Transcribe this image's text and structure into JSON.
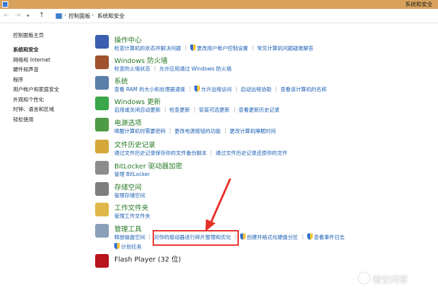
{
  "window": {
    "title": "系统和安全"
  },
  "navbar": {
    "back_icon": "back-arrow-icon",
    "forward_icon": "forward-arrow-icon",
    "recent_icon": "chevron-down-icon",
    "up_icon": "up-arrow-icon",
    "breadcrumbs": [
      "控制面板",
      "系统和安全"
    ]
  },
  "sidebar": {
    "home": "控制面板主页",
    "items": [
      {
        "label": "系统和安全",
        "active": true
      },
      {
        "label": "网络和 Internet"
      },
      {
        "label": "硬件和声音"
      },
      {
        "label": "程序"
      },
      {
        "label": "用户帐户和家庭安全"
      },
      {
        "label": "外观和个性化"
      },
      {
        "label": "时钟、语言和区域"
      },
      {
        "label": "轻松使用"
      }
    ]
  },
  "sections": [
    {
      "title": "操作中心",
      "icon": "flag-icon",
      "color": "#3b5fb0",
      "links": [
        "检查计算机的状态并解决问题",
        "更改用户帐户控制设置",
        "常见计算机问题疑难解答"
      ]
    },
    {
      "title": "Windows 防火墙",
      "icon": "firewall-icon",
      "color": "#a0522d",
      "links": [
        "检查防火墙状态",
        "允许应用通过 Windows 防火墙"
      ]
    },
    {
      "title": "系统",
      "icon": "computer-icon",
      "color": "#5a7fa8",
      "links": [
        "查看 RAM 的大小和处理器速度",
        "允许远程访问",
        "启动远程协助",
        "查看该计算机的名称"
      ]
    },
    {
      "title": "Windows 更新",
      "icon": "windows-update-icon",
      "color": "#3aa64a",
      "links": [
        "启用或关闭自动更新",
        "检查更新",
        "安装可选更新",
        "查看更新历史记录"
      ]
    },
    {
      "title": "电源选项",
      "icon": "battery-icon",
      "color": "#4f9a45",
      "links": [
        "唤醒计算机时需要密码",
        "更改电源按钮的功能",
        "更改计算机睡眠时间"
      ]
    },
    {
      "title": "文件历史记录",
      "icon": "file-history-icon",
      "color": "#d4a93a",
      "links": [
        "通过文件历史记录保存你的文件备份副本",
        "通过文件历史记录还原你的文件"
      ]
    },
    {
      "title": "BitLocker 驱动器加密",
      "icon": "bitlocker-icon",
      "color": "#8c8c8c",
      "links": [
        "管理 BitLocker"
      ]
    },
    {
      "title": "存储空间",
      "icon": "storage-icon",
      "color": "#7d7d7d",
      "links": [
        "管理存储空间"
      ]
    },
    {
      "title": "工作文件夹",
      "icon": "work-folders-icon",
      "color": "#e0b84a",
      "links": [
        "管理工作文件夹"
      ]
    },
    {
      "title": "管理工具",
      "icon": "admin-tools-icon",
      "color": "#8aa0b8",
      "links": [
        "释放磁盘空间",
        "对你的驱动器进行碎片整理和优化",
        "创建并格式化硬盘分区",
        "查看事件日志"
      ],
      "links2": [
        "计划任务"
      ]
    },
    {
      "title": "Flash Player (32 位)",
      "icon": "flash-icon",
      "color": "#b8141b",
      "links": []
    }
  ],
  "annotation": {
    "highlighted_link": "对你的驱动器进行碎片整理和优化",
    "color": "#e8312b"
  },
  "watermark": {
    "text": "悟空问答"
  }
}
